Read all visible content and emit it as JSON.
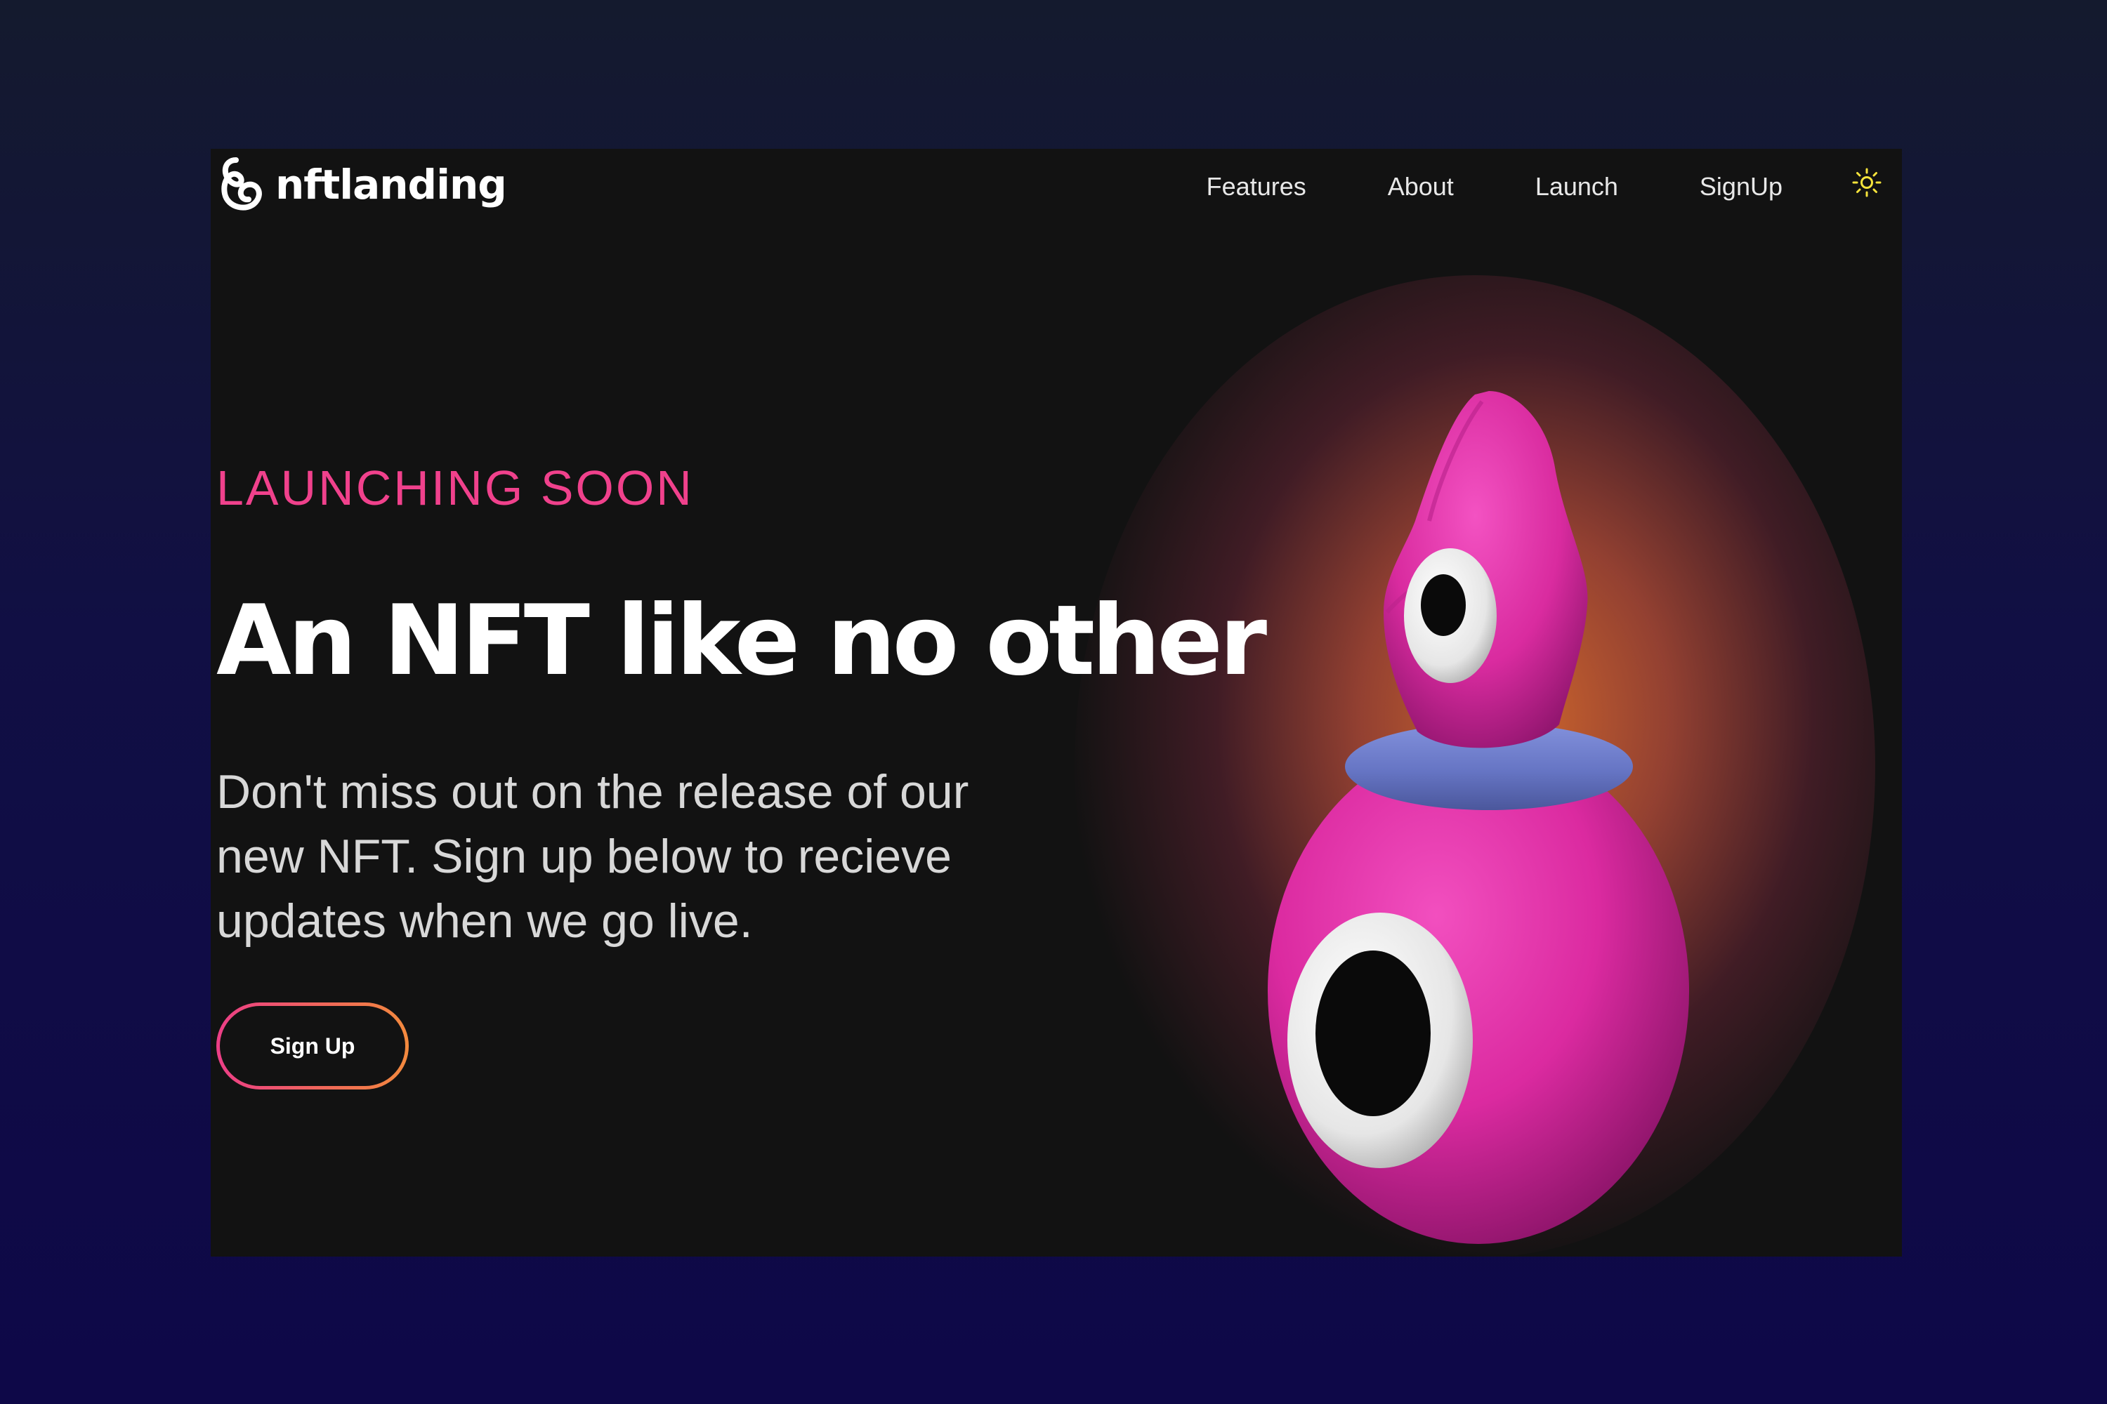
{
  "brand": {
    "name": "nftlanding",
    "logo_icon": "swirl-logo-icon"
  },
  "nav": {
    "links": [
      {
        "label": "Features"
      },
      {
        "label": "About"
      },
      {
        "label": "Launch"
      },
      {
        "label": "SignUp"
      }
    ],
    "theme_toggle_icon": "sun-icon"
  },
  "hero": {
    "eyebrow": "LAUNCHING SOON",
    "title": "An NFT like no other",
    "description": "Don't miss out on the release of our new NFT. Sign up below to recieve updates when we go live.",
    "cta_label": "Sign Up",
    "image_icon": "pink-cyclops-nft-character"
  },
  "colors": {
    "page_background": "#11104a",
    "card_background": "#121212",
    "accent_pink": "#f0418c",
    "accent_orange": "#f38a3e",
    "glow": "#d86a2e",
    "character_pink": "#e02fa4",
    "collar_blue": "#6b78c8",
    "toggle_yellow": "#f5e33b"
  }
}
